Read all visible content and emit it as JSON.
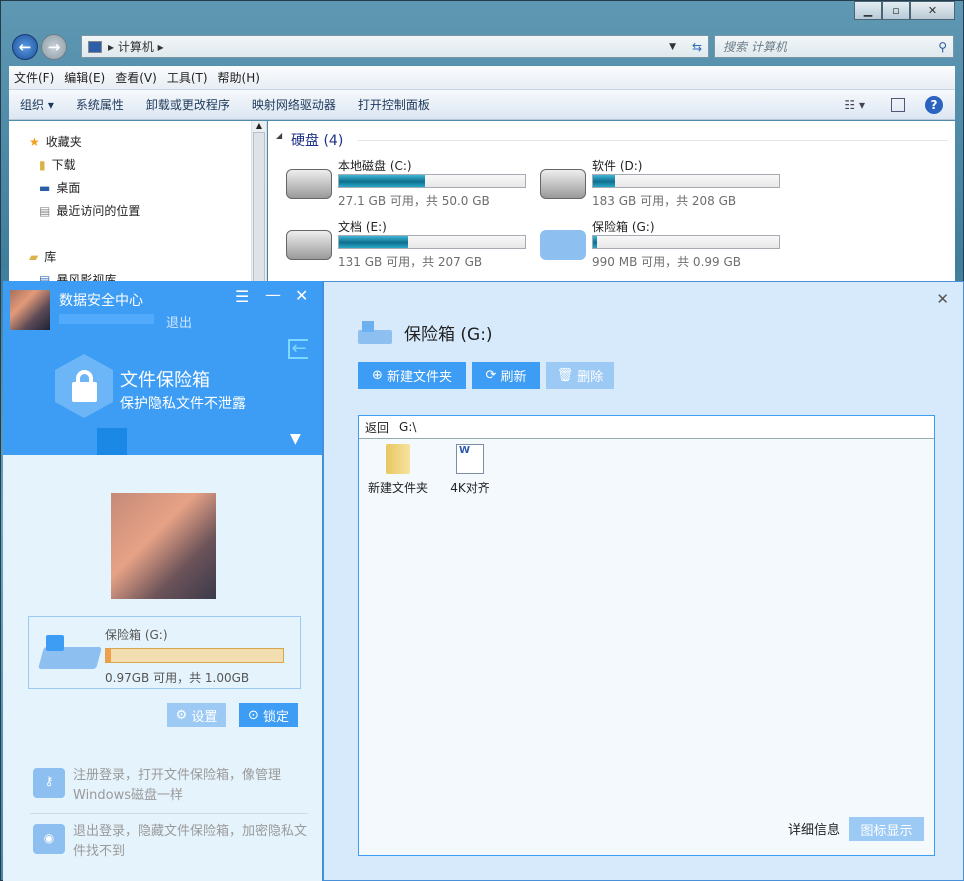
{
  "explorer": {
    "address": "计算机",
    "search_placeholder": "搜索 计算机",
    "menu": [
      "文件(F)",
      "编辑(E)",
      "查看(V)",
      "工具(T)",
      "帮助(H)"
    ],
    "toolbar": [
      "组织 ▾",
      "系统属性",
      "卸载或更改程序",
      "映射网络驱动器",
      "打开控制面板"
    ],
    "nav": {
      "favorites": "收藏夹",
      "items": [
        "下载",
        "桌面",
        "最近访问的位置"
      ],
      "library": "库",
      "library_items": [
        "暴风影视库"
      ]
    },
    "section": "硬盘 (4)",
    "drives": [
      {
        "name": "本地磁盘 (C:)",
        "info": "27.1 GB 可用，共 50.0 GB",
        "used": 0.46
      },
      {
        "name": "软件 (D:)",
        "info": "183 GB 可用，共 208 GB",
        "used": 0.12
      },
      {
        "name": "文档 (E:)",
        "info": "131 GB 可用，共 207 GB",
        "used": 0.37
      },
      {
        "name": "保险箱 (G:)",
        "info": "990 MB 可用，共 0.99 GB",
        "used": 0.02
      }
    ]
  },
  "app": {
    "title": "数据安全中心",
    "logout": "退出",
    "feature_title": "文件保险箱",
    "feature_sub": "保护隐私文件不泄露",
    "vault": {
      "name": "保险箱 (G:)",
      "info": "0.97GB 可用，共 1.00GB",
      "used": 0.03
    },
    "settings": "设置",
    "lock": "锁定",
    "tips": [
      "注册登录，打开文件保险箱，像管理Windows磁盘一样",
      "退出登录，隐藏文件保险箱，加密隐私文件找不到"
    ],
    "panel": {
      "title": "保险箱 (G:)",
      "new_folder": "新建文件夹",
      "refresh": "刷新",
      "delete": "删除",
      "back": "返回",
      "path": "G:\\",
      "files": [
        {
          "name": "新建文件夹",
          "type": "folder"
        },
        {
          "name": "4K对齐",
          "type": "word"
        }
      ],
      "detail": "详细信息",
      "icon_view": "图标显示"
    }
  }
}
